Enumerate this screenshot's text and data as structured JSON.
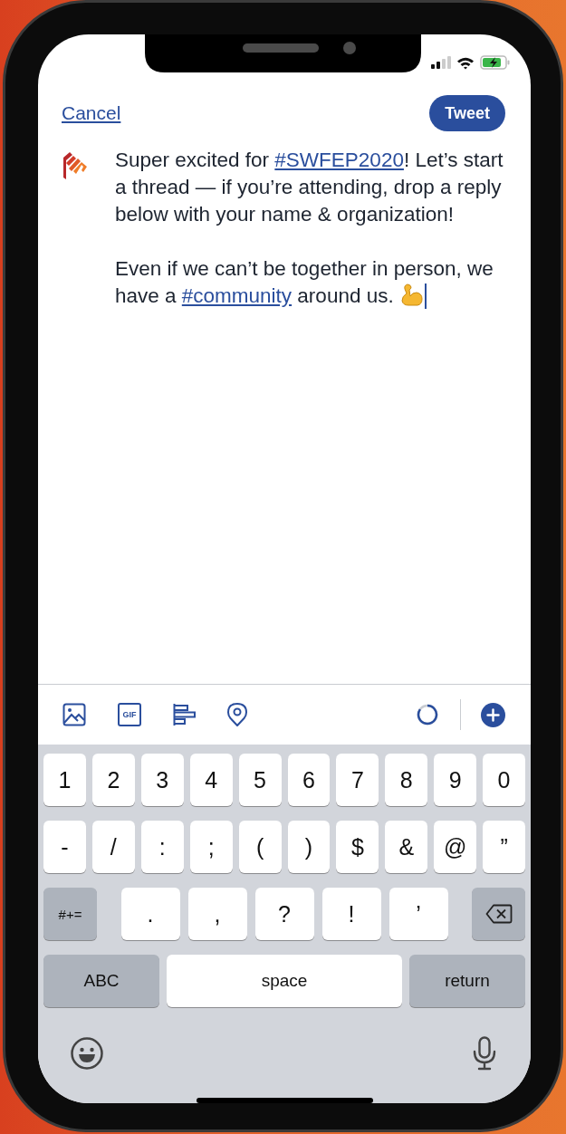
{
  "header": {
    "cancel": "Cancel",
    "tweet_button": "Tweet"
  },
  "compose": {
    "paragraphs": [
      [
        {
          "kind": "text",
          "text": "Super excited for "
        },
        {
          "kind": "hashtag",
          "text": "#SWFEP2020"
        },
        {
          "kind": "text",
          "text": "! Let’s start a thread — if you’re attending, drop a reply below with your name & organization!"
        }
      ],
      [
        {
          "kind": "text",
          "text": "Even if we can’t be together in person, we have a "
        },
        {
          "kind": "hashtag",
          "text": "#community"
        },
        {
          "kind": "text",
          "text": " around us. "
        },
        {
          "kind": "biceps-emoji"
        },
        {
          "kind": "cursor"
        }
      ]
    ]
  },
  "toolbar": {
    "items": [
      {
        "kind": "image"
      },
      {
        "kind": "gif",
        "label": "GIF"
      },
      {
        "kind": "poll"
      },
      {
        "kind": "location"
      }
    ],
    "counter": {
      "level": 0.85
    }
  },
  "keyboard": {
    "number_keys": [
      "1",
      "2",
      "3",
      "4",
      "5",
      "6",
      "7",
      "8",
      "9",
      "0"
    ],
    "symbol_keys": [
      "-",
      "/",
      ":",
      ";",
      "(",
      ")",
      "$",
      "&",
      "@",
      "”"
    ],
    "punctuation_row": {
      "more_symbols_key": "#+=",
      "keys": [
        ".",
        ",",
        "?",
        "!",
        "’"
      ]
    },
    "bottom_row": {
      "letters_key": "ABC",
      "space_key": "space",
      "return_key": "return"
    }
  }
}
